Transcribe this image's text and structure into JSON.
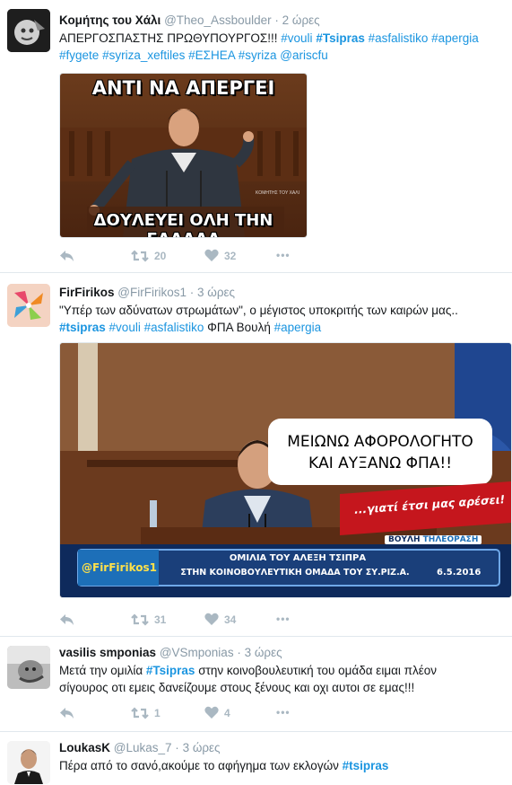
{
  "tweets": [
    {
      "name": "Κομήτης του Χάλι",
      "handle": "@Theo_Assboulder",
      "time": "2 ώρες",
      "lines": [
        [
          {
            "t": "ΑΠΕΡΓΟΣΠΑΣΤΗΣ ΠΡΩΘΥΠΟΥΡΓΟΣ!!! ",
            "k": "text"
          },
          {
            "t": "#vouli",
            "k": "tag"
          },
          {
            "t": " ",
            "k": "text"
          },
          {
            "t": "#Tsipras",
            "k": "tagb"
          },
          {
            "t": " ",
            "k": "text"
          },
          {
            "t": "#asfalistiko",
            "k": "tag"
          },
          {
            "t": " ",
            "k": "text"
          },
          {
            "t": "#apergia",
            "k": "tag"
          }
        ],
        [
          {
            "t": "#fygete",
            "k": "tag"
          },
          {
            "t": " ",
            "k": "text"
          },
          {
            "t": "#syriza_xeftiles",
            "k": "tag"
          },
          {
            "t": " ",
            "k": "text"
          },
          {
            "t": "#ΕΣΗΕΑ",
            "k": "tag"
          },
          {
            "t": " ",
            "k": "text"
          },
          {
            "t": "#syriza",
            "k": "tag"
          },
          {
            "t": " ",
            "k": "text"
          },
          {
            "t": "@ariscfu",
            "k": "tag"
          }
        ]
      ],
      "media": {
        "caption_top": "ΑΝΤΙ ΝΑ ΑΠΕΡΓΕΙ",
        "caption_bottom": "ΔΟΥΛΕΥΕΙ ΟΛΗ ΤΗΝ ΕΛΛΑΔΑ",
        "watermark": "KOMHTHΣ TOY XAΛI"
      },
      "retweets": "20",
      "likes": "32"
    },
    {
      "name": "FirFirikos",
      "handle": "@FirFirikos1",
      "time": "3 ώρες",
      "lines": [
        [
          {
            "t": "\"Υπέρ των αδύνατων στρωμάτων\", ο μέγιστος υποκριτής των καιρών μας..",
            "k": "text"
          }
        ],
        [
          {
            "t": "#tsipras",
            "k": "tagb"
          },
          {
            "t": " ",
            "k": "text"
          },
          {
            "t": "#vouli",
            "k": "tag"
          },
          {
            "t": " ",
            "k": "text"
          },
          {
            "t": "#asfalistiko",
            "k": "tag"
          },
          {
            "t": " ΦΠΑ Βουλή ",
            "k": "text"
          },
          {
            "t": "#apergia",
            "k": "tag"
          }
        ]
      ],
      "media": {
        "bubble_line1": "ΜΕΙΩΝΩ ΑΦΟΡΟΛΟΓΗΤΟ",
        "bubble_line2": "ΚΑΙ ΑΥΞΑΝΩ ΦΠΑ!!",
        "red_banner": "...γιατί έτσι μας αρέσει!",
        "channel_word1": "ΒΟΥΛΗ",
        "channel_word2": "ΤΗΛΕΟΡΑΣΗ",
        "handle_tag": "@FirFirikos1",
        "ticker_line1": "ΟΜΙΛΙΑ ΤΟΥ ΑΛΕΞΗ ΤΣΙΠΡΑ",
        "ticker_line2": "ΣΤΗΝ ΚΟΙΝΟΒΟΥΛΕΥΤΙΚΗ ΟΜΑΔΑ ΤΟΥ ΣΥ.ΡΙΖ.Α.",
        "ticker_date": "6.5.2016"
      },
      "retweets": "31",
      "likes": "34"
    },
    {
      "name": "vasilis smponias",
      "handle": "@VSmponias",
      "time": "3 ώρες",
      "lines": [
        [
          {
            "t": "Μετά την ομιλία ",
            "k": "text"
          },
          {
            "t": "#Tsipras",
            "k": "tagb"
          },
          {
            "t": "  στην κοινοβουλευτική του ομάδα ειμαι πλέον",
            "k": "text"
          }
        ],
        [
          {
            "t": "σίγουρος οτι εμεις δανείζουμε στους ξένους και οχι αυτοι σε εμας!!!",
            "k": "text"
          }
        ]
      ],
      "retweets": "1",
      "likes": "4"
    },
    {
      "name": "LoukasK",
      "handle": "@Lukas_7",
      "time": "3 ώρες",
      "lines": [
        [
          {
            "t": "Πέρα από το σανό,ακούμε το αφήγημα των εκλογών ",
            "k": "text"
          },
          {
            "t": "#tsipras",
            "k": "tagb"
          }
        ]
      ]
    }
  ],
  "ui": {
    "dot": "·",
    "more": "•••"
  },
  "colors": {
    "link": "#1b95e0",
    "meta": "#8899a6",
    "action": "#aab8c2",
    "divider": "#e1e8ed"
  },
  "icons": [
    "reply-icon",
    "retweet-icon",
    "like-icon",
    "more-icon"
  ]
}
